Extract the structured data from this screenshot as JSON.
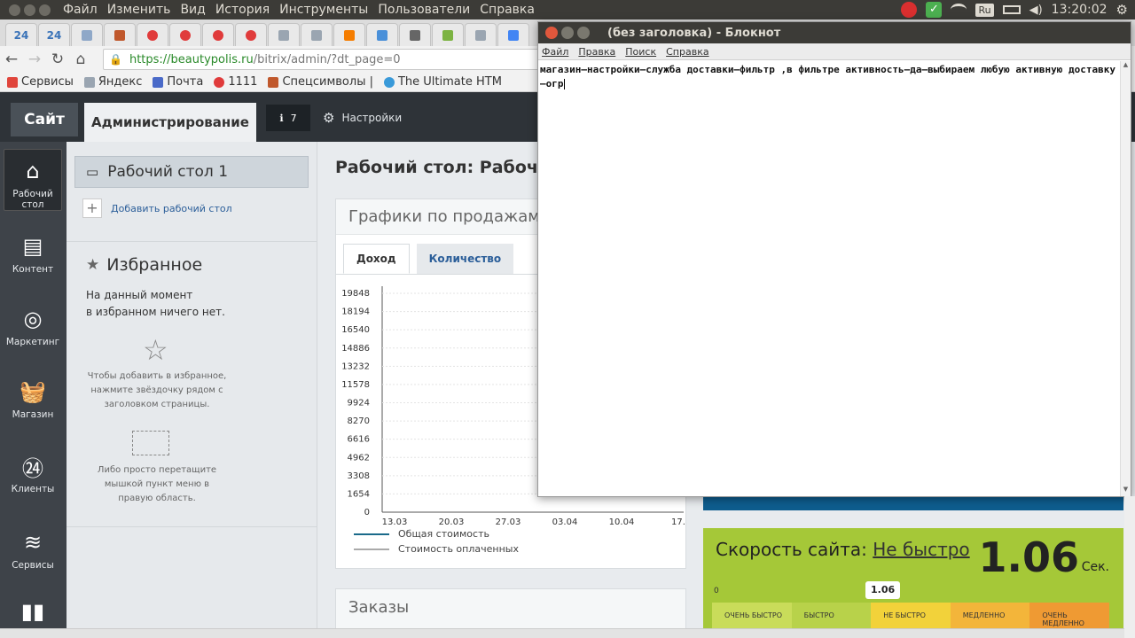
{
  "os_bar": {
    "menu": [
      "Файл",
      "Изменить",
      "Вид",
      "История",
      "Инструменты",
      "Пользователи",
      "Справка"
    ],
    "lang": "Ru",
    "time": "13:20:02"
  },
  "browser": {
    "tabs": [
      {
        "label": "24",
        "icon": "bitrix24-icon",
        "color": "#3a73b8"
      },
      {
        "label": "24",
        "icon": "bitrix24-icon",
        "color": "#3a73b8"
      },
      {
        "label": "",
        "icon": "page-icon",
        "color": "#8fa8c8"
      },
      {
        "label": "",
        "icon": "squares-icon",
        "color": "#c0582c"
      },
      {
        "label": "",
        "icon": "red-circle-icon",
        "color": "#e03b3b"
      },
      {
        "label": "",
        "icon": "red-circle-icon",
        "color": "#e03b3b"
      },
      {
        "label": "",
        "icon": "red-circle-icon",
        "color": "#e03b3b"
      },
      {
        "label": "",
        "icon": "red-circle-icon",
        "color": "#e03b3b"
      },
      {
        "label": "",
        "icon": "document-icon",
        "color": "#9aa5b1"
      },
      {
        "label": "",
        "icon": "document-icon",
        "color": "#9aa5b1"
      },
      {
        "label": "",
        "icon": "blogger-icon",
        "color": "#f57d00"
      },
      {
        "label": "",
        "icon": "check-icon",
        "color": "#4a90d9"
      },
      {
        "label": "",
        "icon": "tool-icon",
        "color": "#666666"
      },
      {
        "label": "",
        "icon": "leaf-icon",
        "color": "#7cb342"
      },
      {
        "label": "",
        "icon": "document-icon",
        "color": "#9aa5b1"
      },
      {
        "label": "",
        "icon": "docs-icon",
        "color": "#4285f4"
      }
    ],
    "url_host": "https://beautypolis.ru",
    "url_path": "/bitrix/admin/?dt_page=0",
    "bookmarks": [
      {
        "label": "Сервисы",
        "icon": "apps-icon",
        "color": "#e0453c"
      },
      {
        "label": "Яндекс",
        "icon": "document-icon",
        "color": "#9aa5b1"
      },
      {
        "label": "Почта",
        "icon": "mail-icon",
        "color": "#4a6ac8"
      },
      {
        "label": "1111",
        "icon": "red-circle-icon",
        "color": "#e03b3b"
      },
      {
        "label": "Спецсимволы |",
        "icon": "squares-icon",
        "color": "#c0582c"
      },
      {
        "label": "The Ultimate HTM",
        "icon": "globe-icon",
        "color": "#3a9ad9"
      }
    ]
  },
  "admin": {
    "site_label": "Сайт",
    "admin_label": "Администрирование",
    "notify_count": "7",
    "settings_label": "Настройки"
  },
  "leftnav": [
    {
      "label": "Рабочий стол",
      "icon": "home-icon"
    },
    {
      "label": "Контент",
      "icon": "document-icon"
    },
    {
      "label": "Маркетинг",
      "icon": "target-icon"
    },
    {
      "label": "Магазин",
      "icon": "basket-icon"
    },
    {
      "label": "Клиенты",
      "icon": "clients-24-icon"
    },
    {
      "label": "Сервисы",
      "icon": "layers-icon"
    },
    {
      "label": "",
      "icon": "bar-chart-icon"
    }
  ],
  "panel": {
    "desktop_label": "Рабочий стол 1",
    "add_desktop": "Добавить рабочий стол",
    "favorites_title": "Избранное",
    "favorites_empty_1": "На данный момент",
    "favorites_empty_2": "в избранном ничего нет.",
    "hint_star": "Чтобы добавить в избранное, нажмите звёздочку рядом с заголовком страницы.",
    "hint_drag": "Либо просто перетащите мышкой пункт меню в правую область."
  },
  "main": {
    "page_title": "Рабочий стол: Рабочи",
    "sales_title": "Графики по продажам",
    "tab_income": "Доход",
    "tab_quantity": "Количество",
    "legend_total": "Общая стоимость",
    "legend_paid": "Стоимость оплаченных",
    "orders_title": "Заказы"
  },
  "chart_data": {
    "type": "line",
    "title": "",
    "xlabel": "",
    "ylabel": "",
    "y_ticks": [
      0,
      1654,
      3308,
      4962,
      6616,
      8270,
      9924,
      11578,
      13232,
      14886,
      16540,
      18194,
      19848
    ],
    "ylim": [
      0,
      19848
    ],
    "x_ticks": [
      "13.03",
      "20.03",
      "27.03",
      "03.04",
      "10.04",
      "17."
    ],
    "series": [
      {
        "name": "Общая стоимость",
        "color": "#1a6a8a"
      },
      {
        "name": "Стоимость оплаченных",
        "color": "#aaaaaa"
      }
    ]
  },
  "speed": {
    "label": "Скорость сайта:",
    "value_text": "Не быстро",
    "number": "1.06",
    "unit": "Сек.",
    "zero": "0",
    "marker": "1.06",
    "scale": [
      {
        "label": "Очень быстро",
        "color": "#c9dc5a"
      },
      {
        "label": "Быстро",
        "color": "#b8d24a"
      },
      {
        "label": "Не быстро",
        "color": "#f2d23a"
      },
      {
        "label": "Медленно",
        "color": "#f3b53a"
      },
      {
        "label": "Очень медленно",
        "color": "#ef9a33"
      }
    ]
  },
  "notepad": {
    "title": "(без заголовка) - Блокнот",
    "menu": [
      "Файл",
      "Правка",
      "Поиск",
      "Справка"
    ],
    "text": "магазин—настройки—служба доставки—фильтр ,в фильтре активность–да—выбираем любую активную доставку—огр"
  }
}
